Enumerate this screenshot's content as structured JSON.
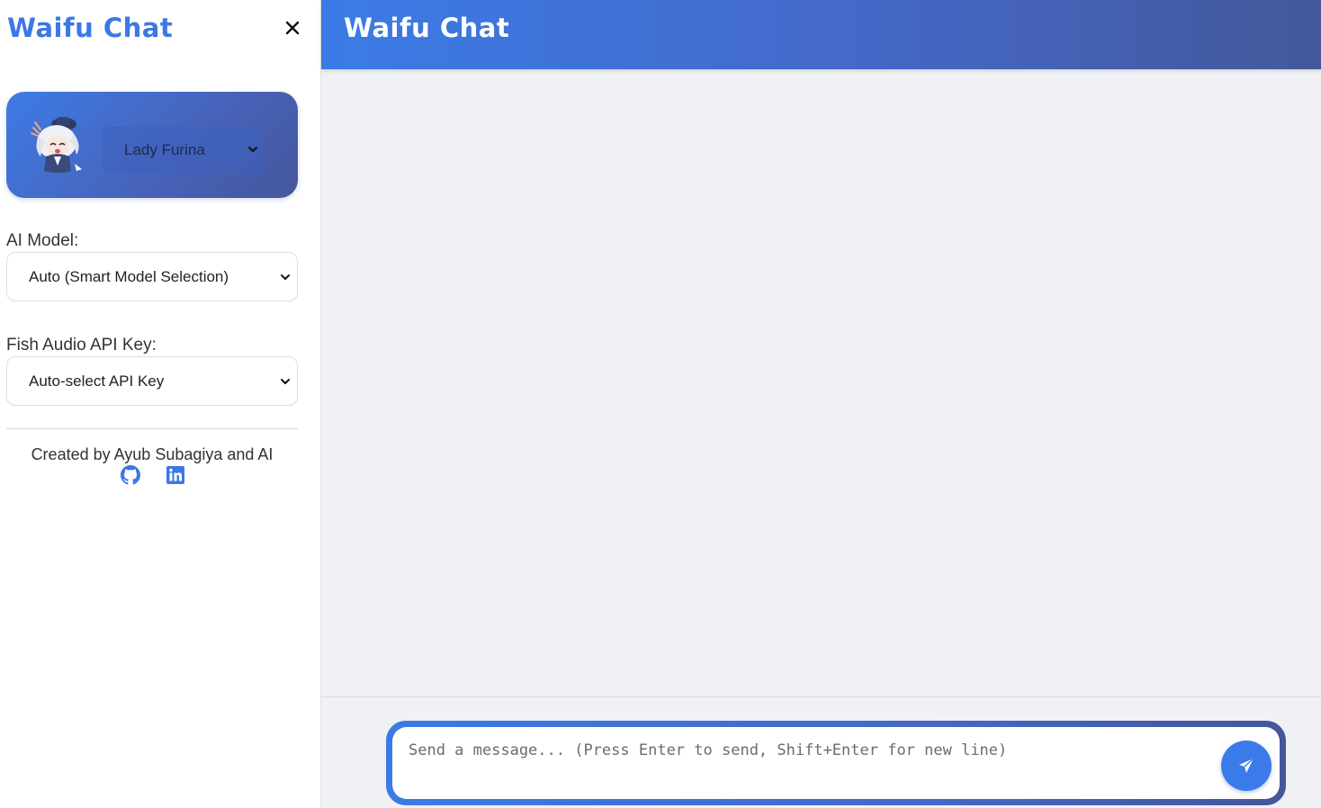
{
  "app": {
    "title": "Waifu Chat"
  },
  "sidebar": {
    "title": "Waifu Chat",
    "close_icon": "close-icon",
    "character": {
      "avatar_icon": "character-avatar",
      "selected": "Lady Furina"
    },
    "ai_model": {
      "label": "AI Model:",
      "selected": "Auto (Smart Model Selection)"
    },
    "fish_audio": {
      "label": "Fish Audio API Key:",
      "selected": "Auto-select API Key"
    },
    "credit": "Created by Ayub Subagiya and AI",
    "social": [
      {
        "name": "github-icon",
        "color": "#3b78e6"
      },
      {
        "name": "linkedin-icon",
        "color": "#3b78e6"
      }
    ]
  },
  "header": {
    "title": "Waifu Chat"
  },
  "composer": {
    "placeholder": "Send a message... (Press Enter to send, Shift+Enter for new line)",
    "value": "",
    "send_icon": "send-icon"
  },
  "colors": {
    "accent": "#3b78e6",
    "accent_dark": "#44579a",
    "background": "#f0f1f5"
  }
}
